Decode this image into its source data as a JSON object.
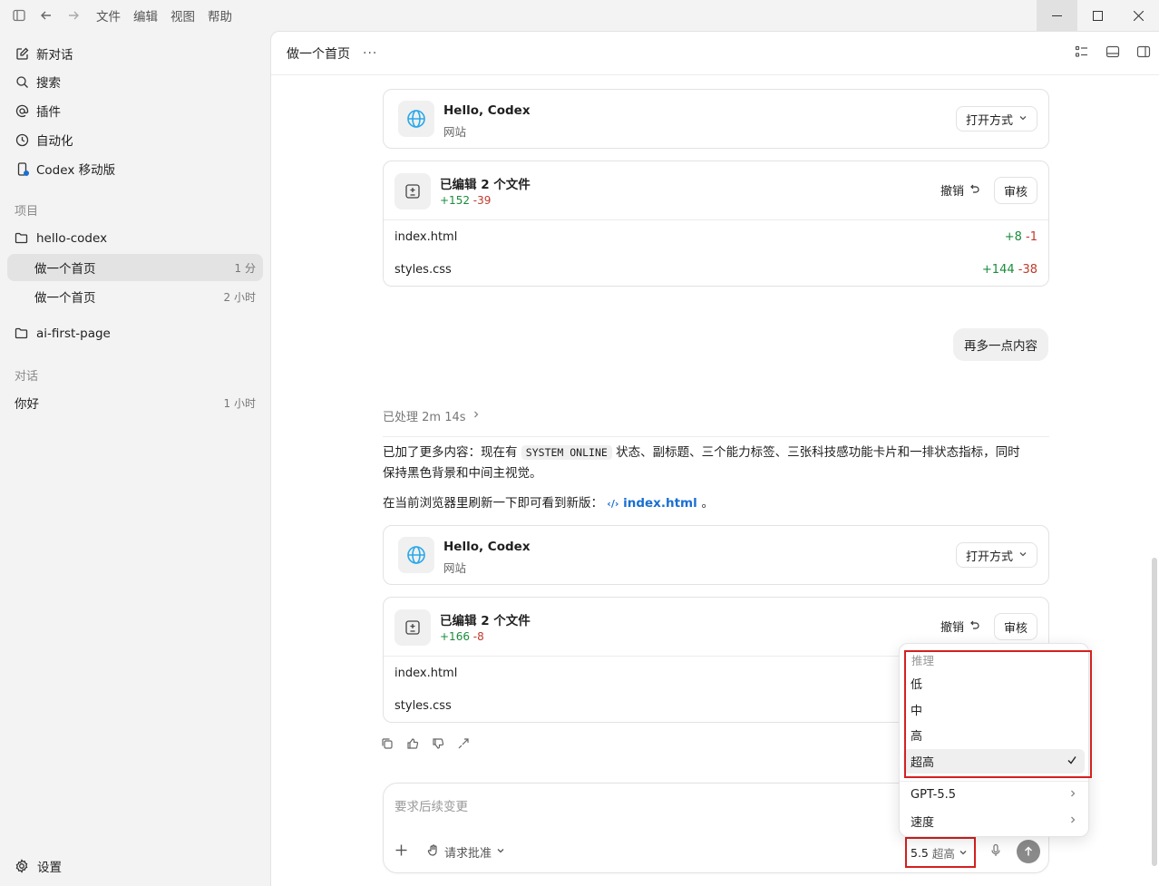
{
  "menubar": {
    "menus": [
      "文件",
      "编辑",
      "视图",
      "帮助"
    ]
  },
  "sidebar": {
    "nav": [
      {
        "label": "新对话",
        "icon": "edit-icon"
      },
      {
        "label": "搜索",
        "icon": "search-icon"
      },
      {
        "label": "插件",
        "icon": "at-icon"
      },
      {
        "label": "自动化",
        "icon": "clock-icon"
      },
      {
        "label": "Codex 移动版",
        "icon": "phone-icon"
      }
    ],
    "projects_label": "项目",
    "projects": [
      {
        "name": "hello-codex",
        "threads": [
          {
            "title": "做一个首页",
            "age": "1 分",
            "active": true
          },
          {
            "title": "做一个首页",
            "age": "2 小时",
            "active": false
          }
        ]
      },
      {
        "name": "ai-first-page",
        "threads": []
      }
    ],
    "chats_label": "对话",
    "chats": [
      {
        "title": "你好",
        "age": "1 小时"
      }
    ],
    "settings_label": "设置"
  },
  "main": {
    "title": "做一个首页",
    "web_card_1": {
      "title": "Hello, Codex",
      "subtitle": "网站",
      "open_label": "打开方式"
    },
    "files_card_1": {
      "title": "已编辑 2 个文件",
      "plus": "+152",
      "minus": "-39",
      "undo_label": "撤销",
      "review_label": "审核",
      "files": [
        {
          "name": "index.html",
          "plus": "+8",
          "minus": "-1"
        },
        {
          "name": "styles.css",
          "plus": "+144",
          "minus": "-38"
        }
      ]
    },
    "user_message": "再多一点内容",
    "processed": "已处理 2m 14s",
    "reply": {
      "p1_a": "已加了更多内容：现在有",
      "p1_code": "SYSTEM ONLINE",
      "p1_b": "状态、副标题、三个能力标签、三张科技感功能卡片和一排状态指标，同时",
      "p1_c": "保持黑色背景和中间主视觉。",
      "p2_a": "在当前浏览器里刷新一下即可看到新版：",
      "p2_link": "index.html",
      "p2_b": "。"
    },
    "web_card_2": {
      "title": "Hello, Codex",
      "subtitle": "网站",
      "open_label": "打开方式"
    },
    "files_card_2": {
      "title": "已编辑 2 个文件",
      "plus": "+166",
      "minus": "-8",
      "undo_label": "撤销",
      "review_label": "审核",
      "files": [
        {
          "name": "index.html"
        },
        {
          "name": "styles.css"
        }
      ]
    }
  },
  "composer": {
    "placeholder": "要求后续变更",
    "approval_label": "请求批准",
    "model_version": "5.5",
    "reasoning_level": "超高"
  },
  "dropdown": {
    "label": "推理",
    "levels": [
      "低",
      "中",
      "高",
      "超高"
    ],
    "selected": "超高",
    "model_label": "GPT-5.5",
    "speed_label": "速度"
  },
  "colors": {
    "accent_red": "#d42020",
    "plus": "#1a8b3a",
    "minus": "#c0392b",
    "link": "#1a6fd1"
  }
}
